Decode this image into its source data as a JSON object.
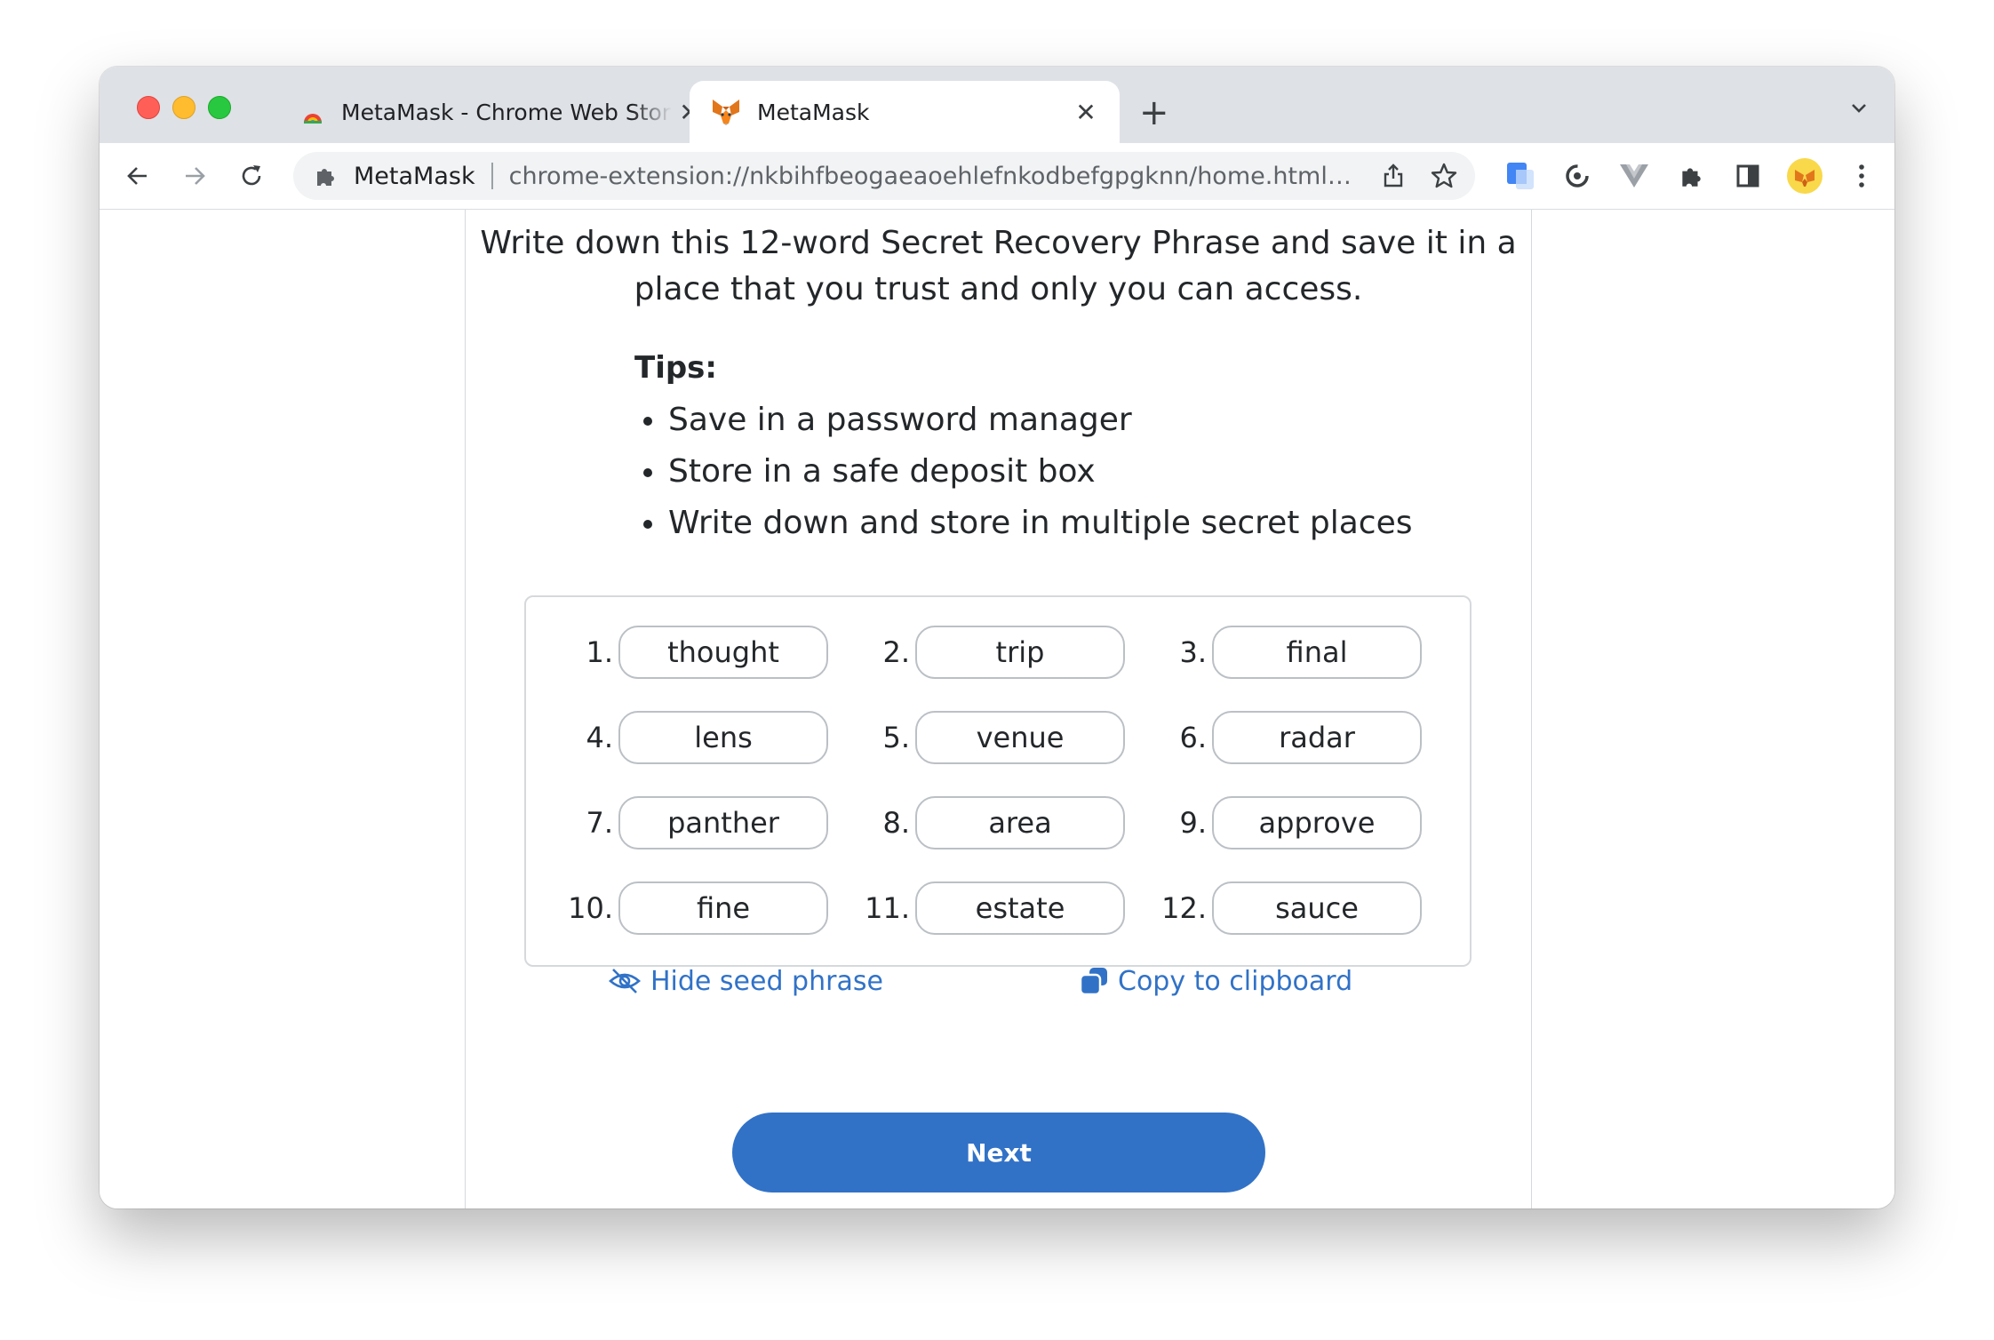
{
  "browser": {
    "tabs": [
      {
        "title": "MetaMask - Chrome Web Store",
        "close": "✕"
      },
      {
        "title": "MetaMask",
        "close": "✕"
      }
    ],
    "new_tab": "+",
    "omnibox": {
      "site": "MetaMask",
      "url": "chrome-extension://nkbihfbeogaeaoehlefnkodbefgpgknn/home.html#o..."
    }
  },
  "page": {
    "intro_line1": "Write down this 12-word Secret Recovery Phrase and save it in a",
    "intro_line2": "place that you trust and only you can access.",
    "tips_title": "Tips:",
    "tips": [
      "Save in a password manager",
      "Store in a safe deposit box",
      "Write down and store in multiple secret places"
    ],
    "words": [
      {
        "num": "1.",
        "word": "thought"
      },
      {
        "num": "2.",
        "word": "trip"
      },
      {
        "num": "3.",
        "word": "final"
      },
      {
        "num": "4.",
        "word": "lens"
      },
      {
        "num": "5.",
        "word": "venue"
      },
      {
        "num": "6.",
        "word": "radar"
      },
      {
        "num": "7.",
        "word": "panther"
      },
      {
        "num": "8.",
        "word": "area"
      },
      {
        "num": "9.",
        "word": "approve"
      },
      {
        "num": "10.",
        "word": "fine"
      },
      {
        "num": "11.",
        "word": "estate"
      },
      {
        "num": "12.",
        "word": "sauce"
      }
    ],
    "hide_label": "Hide seed phrase",
    "copy_label": "Copy to clipboard",
    "next_label": "Next"
  },
  "colors": {
    "accent": "#3172c7",
    "text": "#24272a",
    "pill_border": "#bbc0c5"
  }
}
